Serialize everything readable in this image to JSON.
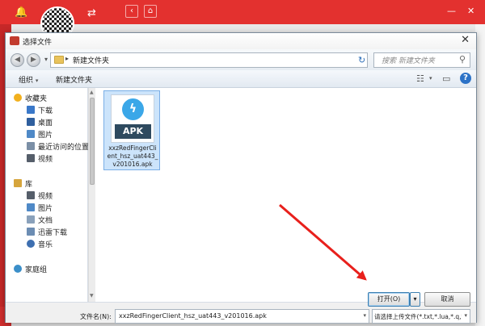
{
  "dialog": {
    "title": "选择文件",
    "close_glyph": "✕",
    "address": {
      "path": "新建文件夹",
      "separator": "▸"
    },
    "search_placeholder": "搜索 新建文件夹",
    "toolbar": {
      "organize": "组织",
      "new_folder": "新建文件夹"
    },
    "nav_items": [
      {
        "label": "收藏夹",
        "icon": "star-icon",
        "color": "#f2b01e"
      },
      {
        "label": "下载",
        "icon": "download-folder-icon",
        "color": "#3a78c9"
      },
      {
        "label": "桌面",
        "icon": "desktop-icon",
        "color": "#2f5f9e"
      },
      {
        "label": "图片",
        "icon": "pictures-icon",
        "color": "#4f89c7"
      },
      {
        "label": "最近访问的位置",
        "icon": "recent-places-icon",
        "color": "#7b8fa6"
      },
      {
        "label": "视频",
        "icon": "videos-icon",
        "color": "#555e6a"
      },
      {
        "label": "库",
        "icon": "library-icon",
        "color": "#d6a53c"
      },
      {
        "label": "视频",
        "icon": "videos-icon",
        "color": "#555e6a"
      },
      {
        "label": "图片",
        "icon": "pictures-icon",
        "color": "#4f89c7"
      },
      {
        "label": "文档",
        "icon": "documents-icon",
        "color": "#8aa1bb"
      },
      {
        "label": "迅雷下载",
        "icon": "thunder-download-icon",
        "color": "#6c8db3"
      },
      {
        "label": "音乐",
        "icon": "music-icon",
        "color": "#3e6fb0"
      },
      {
        "label": "家庭组",
        "icon": "homegroup-icon",
        "color": "#3b8fc9"
      }
    ],
    "file": {
      "name": "xxzRedFingerClient_hsz_uat443_v201016.apk",
      "icon_text": "APK",
      "type_icon": "apk-file-icon"
    },
    "filename_label": "文件名(N):",
    "filename_value": "xxzRedFingerClient_hsz_uat443_v201016.apk",
    "filetype_value": "请选择上传文件(*.txt,*.lua,*.q,*.",
    "open_label": "打开(O)",
    "cancel_label": "取消"
  },
  "background_app": {
    "accent": "#e3312f",
    "icons": [
      "bell-icon",
      "swap-icon",
      "back-icon",
      "home-icon",
      "minimize-icon",
      "close-icon"
    ]
  },
  "annotation": {
    "arrow_color": "#e8201c"
  }
}
